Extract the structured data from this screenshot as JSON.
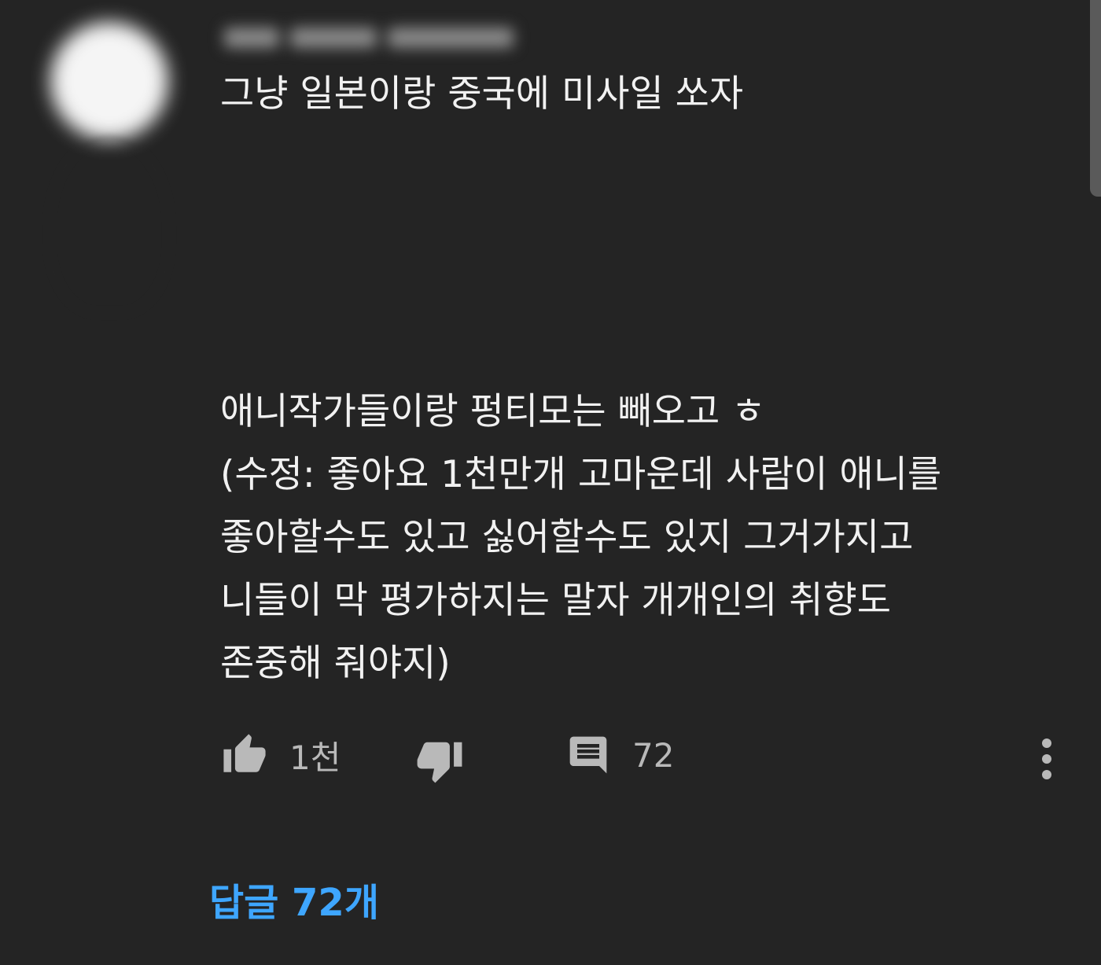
{
  "comment": {
    "title": "그냥 일본이랑 중국에 미사일 쏘자",
    "body_lines": [
      "애니작가들이랑 펑티모는 빼오고 ㅎ",
      "(수정: 좋아요 1천만개 고마운데 사람이 애니를",
      "좋아할수도 있고 싫어할수도 있지 그거가지고",
      "니들이 막 평가하지는 말자 개개인의 취향도",
      "존중해 줘야지)"
    ]
  },
  "actions": {
    "like_count": "1천",
    "reply_count": "72"
  },
  "replies_link": "답글 72개",
  "icons": {
    "like": "thumb-up-icon",
    "dislike": "thumb-down-icon",
    "reply": "comment-icon",
    "more": "more-vert-icon"
  },
  "colors": {
    "background": "#242424",
    "text": "#f1f1f1",
    "muted": "#b9b9b9",
    "link": "#3ea6ff"
  }
}
